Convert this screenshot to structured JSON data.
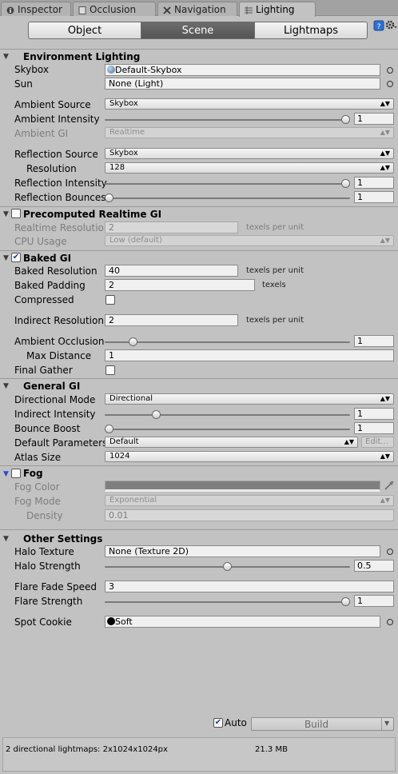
{
  "tabs": {
    "inspector": "Inspector",
    "occlusion": "Occlusion",
    "navigation": "Navigation",
    "lighting": "Lighting"
  },
  "toolbar": {
    "object": "Object",
    "scene": "Scene",
    "lightmaps": "Lightmaps"
  },
  "environment": {
    "header": "Environment Lighting",
    "skybox_label": "Skybox",
    "skybox_value": "Default-Skybox",
    "sun_label": "Sun",
    "sun_value": "None (Light)",
    "ambient_source_label": "Ambient Source",
    "ambient_source_value": "Skybox",
    "ambient_intensity_label": "Ambient Intensity",
    "ambient_intensity_value": "1",
    "ambient_intensity_level": 1,
    "ambient_gi_label": "Ambient GI",
    "ambient_gi_value": "Realtime",
    "reflection_source_label": "Reflection Source",
    "reflection_source_value": "Skybox",
    "resolution_label": "Resolution",
    "resolution_value": "128",
    "reflection_intensity_label": "Reflection Intensity",
    "reflection_intensity_value": "1",
    "reflection_intensity_level": 1,
    "reflection_bounces_label": "Reflection Bounces",
    "reflection_bounces_value": "1",
    "reflection_bounces_level": 0
  },
  "realtime_gi": {
    "header": "Precomputed Realtime GI",
    "enabled": false,
    "realtime_resolution_label": "Realtime Resolution",
    "realtime_resolution_value": "2",
    "realtime_resolution_unit": "texels per unit",
    "cpu_usage_label": "CPU Usage",
    "cpu_usage_value": "Low (default)"
  },
  "baked_gi": {
    "header": "Baked GI",
    "enabled": true,
    "baked_resolution_label": "Baked Resolution",
    "baked_resolution_value": "40",
    "baked_resolution_unit": "texels per unit",
    "baked_padding_label": "Baked Padding",
    "baked_padding_value": "2",
    "baked_padding_unit": "texels",
    "compressed_label": "Compressed",
    "compressed": false,
    "indirect_resolution_label": "Indirect Resolution",
    "indirect_resolution_value": "2",
    "indirect_resolution_unit": "texels per unit",
    "ambient_occlusion_label": "Ambient Occlusion",
    "ambient_occlusion_value": "1",
    "ambient_occlusion_level": 0.1,
    "max_distance_label": "Max Distance",
    "max_distance_value": "1",
    "final_gather_label": "Final Gather",
    "final_gather": false
  },
  "general_gi": {
    "header": "General GI",
    "directional_mode_label": "Directional Mode",
    "directional_mode_value": "Directional",
    "indirect_intensity_label": "Indirect Intensity",
    "indirect_intensity_value": "1",
    "indirect_intensity_level": 0.2,
    "bounce_boost_label": "Bounce Boost",
    "bounce_boost_value": "1",
    "bounce_boost_level": 0,
    "default_parameters_label": "Default Parameters",
    "default_parameters_value": "Default",
    "edit_label": "Edit...",
    "atlas_size_label": "Atlas Size",
    "atlas_size_value": "1024"
  },
  "fog": {
    "header": "Fog",
    "enabled": false,
    "fog_color_label": "Fog Color",
    "fog_mode_label": "Fog Mode",
    "fog_mode_value": "Exponential",
    "density_label": "Density",
    "density_value": "0.01"
  },
  "other": {
    "header": "Other Settings",
    "halo_texture_label": "Halo Texture",
    "halo_texture_value": "None (Texture 2D)",
    "halo_strength_label": "Halo Strength",
    "halo_strength_value": "0.5",
    "halo_strength_level": 0.5,
    "flare_fade_speed_label": "Flare Fade Speed",
    "flare_fade_speed_value": "3",
    "flare_strength_label": "Flare Strength",
    "flare_strength_value": "1",
    "flare_strength_level": 1,
    "spot_cookie_label": "Spot Cookie",
    "spot_cookie_value": "Soft"
  },
  "build": {
    "auto_label": "Auto",
    "auto": true,
    "build_label": "Build"
  },
  "status": {
    "lightmaps": "2 directional lightmaps: 2x1024x1024px",
    "size": "21.3 MB"
  }
}
